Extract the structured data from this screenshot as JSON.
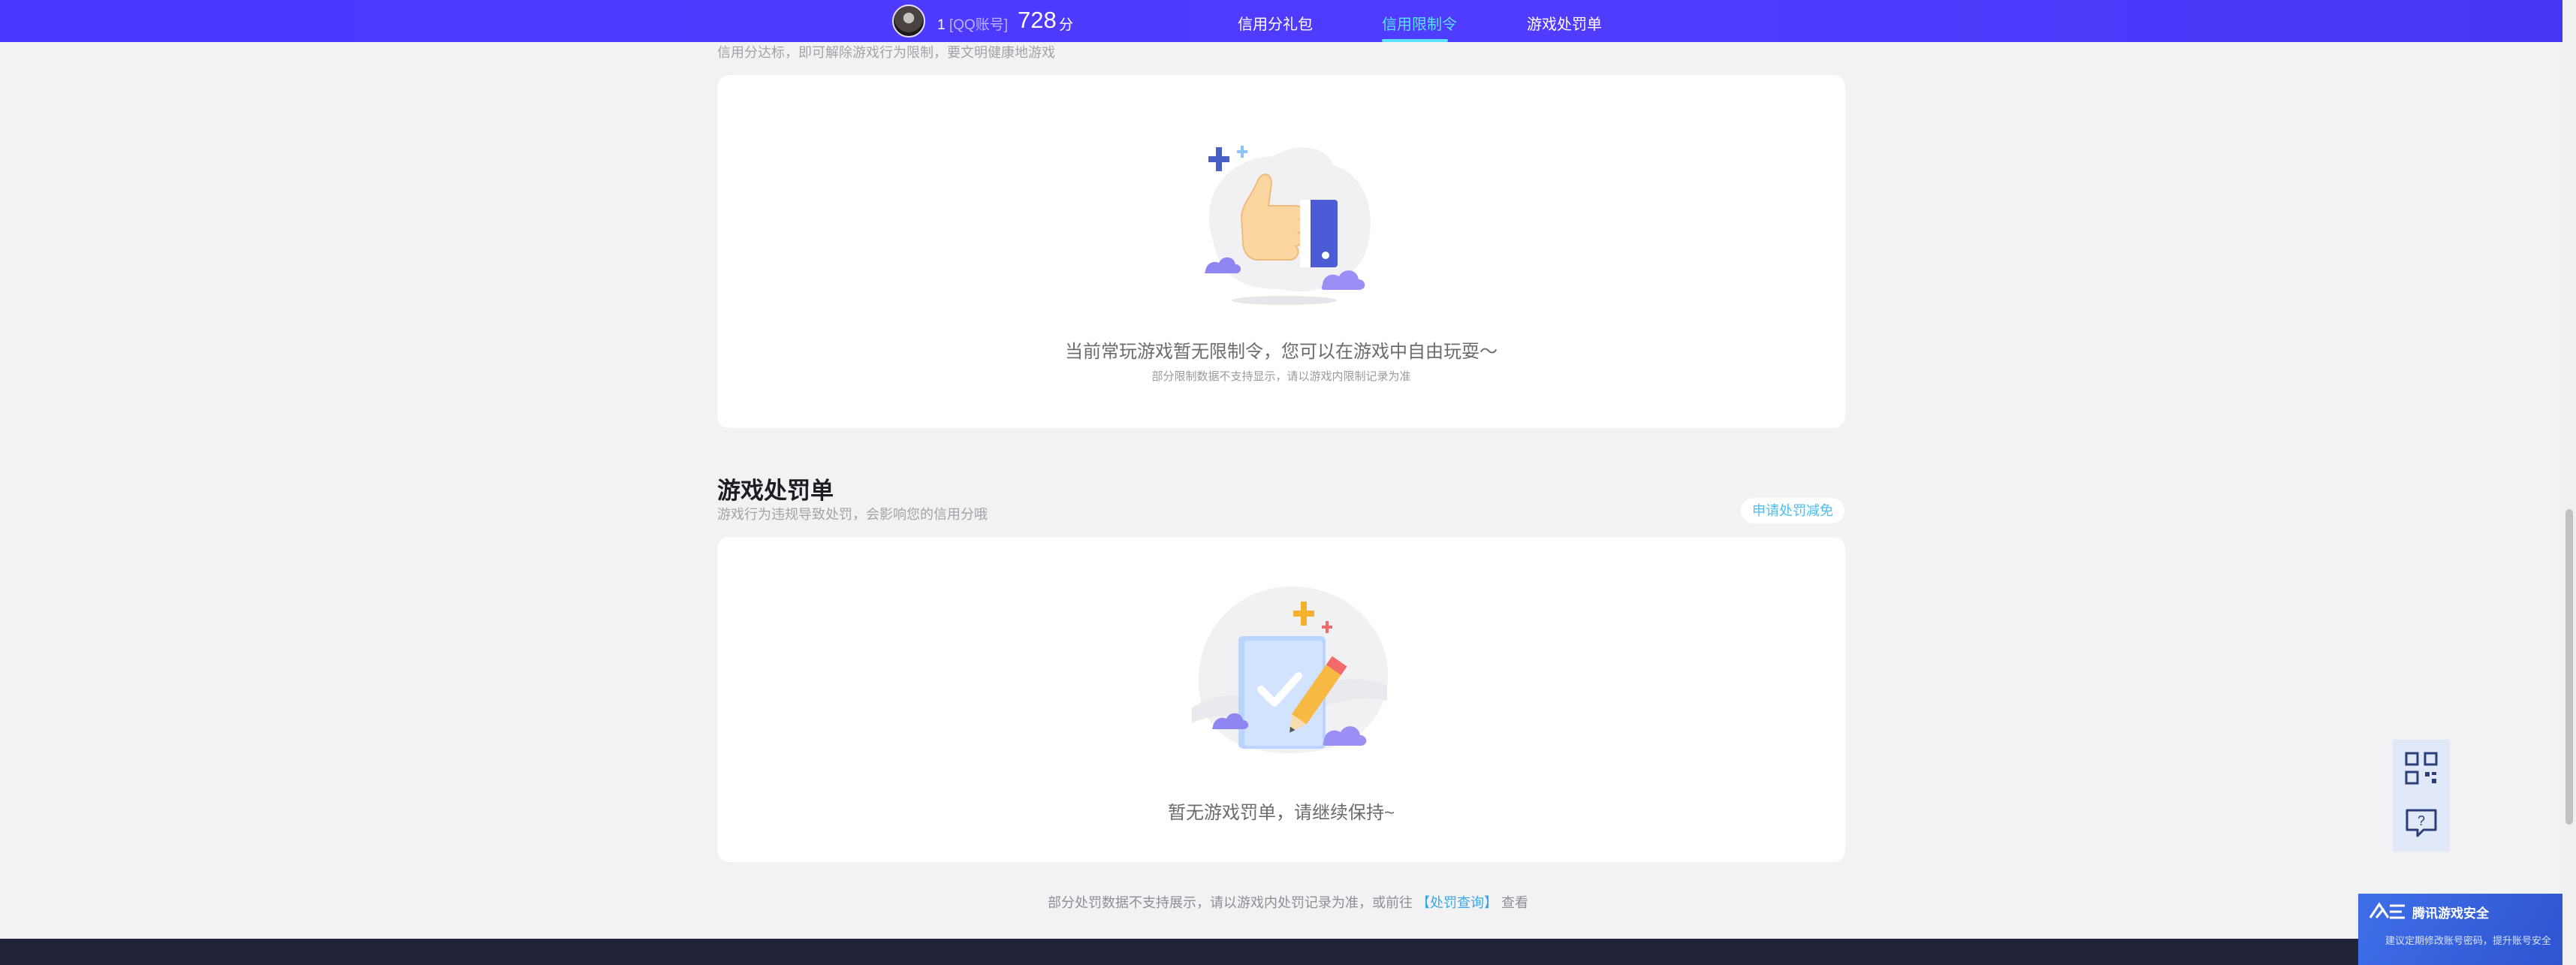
{
  "header": {
    "user_id": "1",
    "account_type": "[QQ账号]",
    "credit_score": "728",
    "score_unit": "分",
    "tabs": [
      {
        "label": "信用分礼包",
        "active": false
      },
      {
        "label": "信用限制令",
        "active": true
      },
      {
        "label": "游戏处罚单",
        "active": false
      }
    ]
  },
  "restriction_section": {
    "subtitle": "信用分达标，即可解除游戏行为限制，要文明健康地游戏",
    "empty_message": "当前常玩游戏暂无限制令，您可以在游戏中自由玩耍～",
    "note": "部分限制数据不支持显示，请以游戏内限制记录为准"
  },
  "penalty_section": {
    "title": "游戏处罚单",
    "subtitle": "游戏行为违规导致处罚，会影响您的信用分哦",
    "appeal_button": "申请处罚减免",
    "empty_message": "暂无游戏罚单，请继续保持~"
  },
  "footer": {
    "note_prefix": "部分处罚数据不支持展示，请以游戏内处罚记录为准，或前往",
    "link": "【处罚查询】",
    "note_suffix": "查看"
  },
  "promo": {
    "title": "腾讯游戏安全",
    "subtitle": "建议定期修改账号密码，提升账号安全"
  },
  "colors": {
    "header_bg": "#4b36ff",
    "active_tab": "#5ce1ff",
    "link": "#3aa8e6",
    "page_bg": "#f2f2f4"
  },
  "icons": [
    "thumbs-up-illustration",
    "checklist-pencil-illustration",
    "qr-code-icon",
    "help-chat-icon"
  ]
}
